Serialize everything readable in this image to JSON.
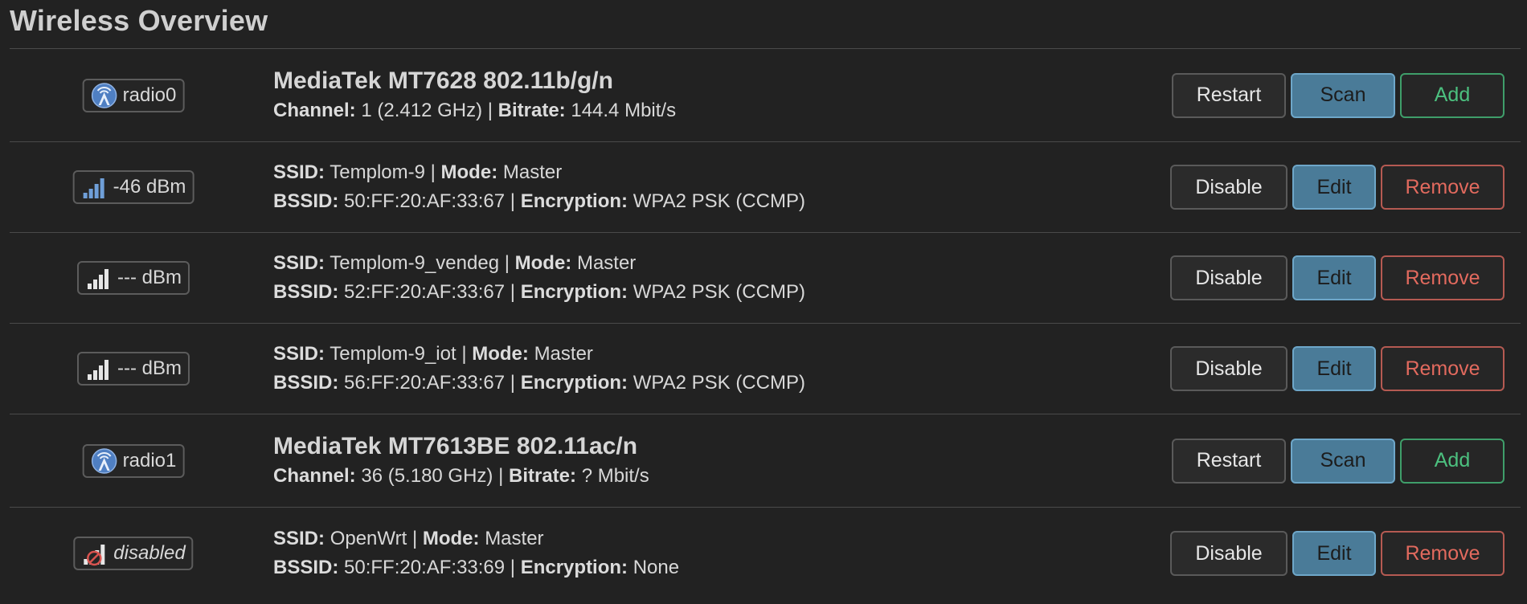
{
  "page": {
    "title": "Wireless Overview"
  },
  "colors": {
    "background": "#222222",
    "scan_edit_button": "#4a7b98",
    "add_button_border": "#3f9e6a",
    "remove_button_border": "#b55a52"
  },
  "rows": [
    {
      "type": "device",
      "badge": {
        "icon": "radio-antenna-icon",
        "text": "radio0"
      },
      "name": "MediaTek MT7628 802.11b/g/n",
      "details": {
        "channel_label": "Channel:",
        "channel_value": "1 (2.412 GHz)",
        "bitrate_label": "Bitrate:",
        "bitrate_value": "144.4 Mbit/s"
      },
      "buttons": {
        "restart": "Restart",
        "scan": "Scan",
        "add": "Add"
      }
    },
    {
      "type": "network",
      "badge": {
        "icon": "signal-strength-icon",
        "text": "-46 dBm"
      },
      "line1": {
        "ssid_label": "SSID:",
        "ssid_value": "Templom-9",
        "mode_label": "Mode:",
        "mode_value": "Master"
      },
      "line2": {
        "bssid_label": "BSSID:",
        "bssid_value": "50:FF:20:AF:33:67",
        "enc_label": "Encryption:",
        "enc_value": "WPA2 PSK (CCMP)"
      },
      "buttons": {
        "disable": "Disable",
        "edit": "Edit",
        "remove": "Remove"
      }
    },
    {
      "type": "network",
      "badge": {
        "icon": "signal-none-icon",
        "text": "--- dBm"
      },
      "line1": {
        "ssid_label": "SSID:",
        "ssid_value": "Templom-9_vendeg",
        "mode_label": "Mode:",
        "mode_value": "Master"
      },
      "line2": {
        "bssid_label": "BSSID:",
        "bssid_value": "52:FF:20:AF:33:67",
        "enc_label": "Encryption:",
        "enc_value": "WPA2 PSK (CCMP)"
      },
      "buttons": {
        "disable": "Disable",
        "edit": "Edit",
        "remove": "Remove"
      }
    },
    {
      "type": "network",
      "badge": {
        "icon": "signal-none-icon",
        "text": "--- dBm"
      },
      "line1": {
        "ssid_label": "SSID:",
        "ssid_value": "Templom-9_iot",
        "mode_label": "Mode:",
        "mode_value": "Master"
      },
      "line2": {
        "bssid_label": "BSSID:",
        "bssid_value": "56:FF:20:AF:33:67",
        "enc_label": "Encryption:",
        "enc_value": "WPA2 PSK (CCMP)"
      },
      "buttons": {
        "disable": "Disable",
        "edit": "Edit",
        "remove": "Remove"
      }
    },
    {
      "type": "device",
      "badge": {
        "icon": "radio-antenna-icon",
        "text": "radio1"
      },
      "name": "MediaTek MT7613BE 802.11ac/n",
      "details": {
        "channel_label": "Channel:",
        "channel_value": "36 (5.180 GHz)",
        "bitrate_label": "Bitrate:",
        "bitrate_value": "? Mbit/s"
      },
      "buttons": {
        "restart": "Restart",
        "scan": "Scan",
        "add": "Add"
      }
    },
    {
      "type": "network",
      "badge": {
        "icon": "signal-disabled-icon",
        "text": "disabled"
      },
      "line1": {
        "ssid_label": "SSID:",
        "ssid_value": "OpenWrt",
        "mode_label": "Mode:",
        "mode_value": "Master"
      },
      "line2": {
        "bssid_label": "BSSID:",
        "bssid_value": "50:FF:20:AF:33:69",
        "enc_label": "Encryption:",
        "enc_value": "None"
      },
      "buttons": {
        "disable": "Disable",
        "edit": "Edit",
        "remove": "Remove"
      }
    }
  ]
}
